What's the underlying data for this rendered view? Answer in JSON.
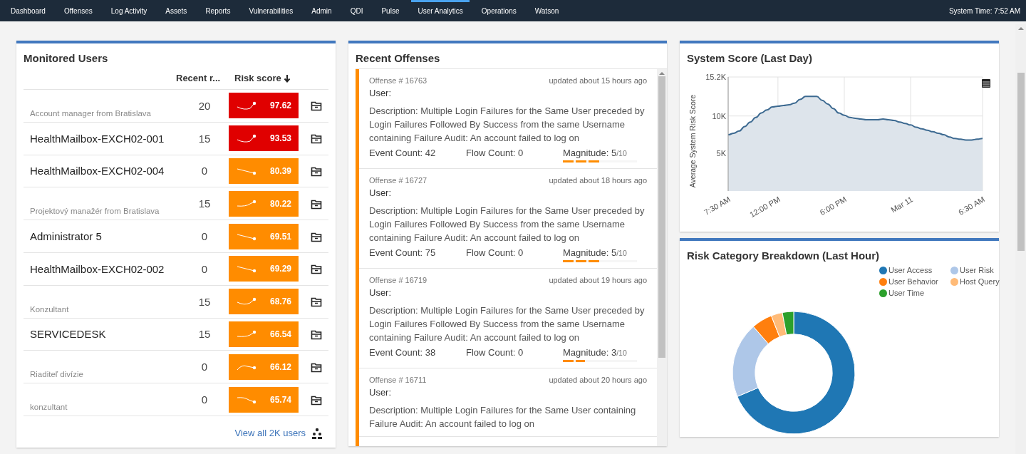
{
  "nav": {
    "items": [
      {
        "label": "Dashboard",
        "selected": false
      },
      {
        "label": "Offenses",
        "selected": false
      },
      {
        "label": "Log Activity",
        "selected": false
      },
      {
        "label": "Assets",
        "selected": false
      },
      {
        "label": "Reports",
        "selected": false
      },
      {
        "label": "Vulnerabilities",
        "selected": false
      },
      {
        "label": "Admin",
        "selected": false
      },
      {
        "label": "QDI",
        "selected": false
      },
      {
        "label": "Pulse",
        "selected": false
      },
      {
        "label": "User Analytics",
        "selected": true
      },
      {
        "label": "Operations",
        "selected": false
      },
      {
        "label": "Watson",
        "selected": false
      }
    ],
    "system_time": "System Time: 7:52 AM"
  },
  "monitored_users": {
    "title": "Monitored Users",
    "columns": [
      "Recent r...",
      "Risk score"
    ],
    "rows": [
      {
        "kind": "subtitle",
        "name": "Account manager from Bratislava",
        "recent": "20",
        "score": "97.62",
        "color": "#e00000"
      },
      {
        "kind": "name",
        "name": "HealthMailbox-EXCH02-001",
        "recent": "15",
        "score": "93.53",
        "color": "#e00000"
      },
      {
        "kind": "name",
        "name": "HealthMailbox-EXCH02-004",
        "recent": "0",
        "score": "80.39",
        "color": "#ff8c00"
      },
      {
        "kind": "subtitle",
        "name": "Projektový manažér from Bratislava",
        "recent": "15",
        "score": "80.22",
        "color": "#ff8c00"
      },
      {
        "kind": "name",
        "name": "Administrator 5",
        "recent": "0",
        "score": "69.51",
        "color": "#ff8c00"
      },
      {
        "kind": "name",
        "name": "HealthMailbox-EXCH02-002",
        "recent": "0",
        "score": "69.29",
        "color": "#ff8c00"
      },
      {
        "kind": "subtitle",
        "name": "Konzultant",
        "recent": "15",
        "score": "68.76",
        "color": "#ff8c00"
      },
      {
        "kind": "name",
        "name": "SERVICEDESK",
        "recent": "15",
        "score": "66.54",
        "color": "#ff8c00"
      },
      {
        "kind": "subtitle",
        "name": "Riaditeľ divízie",
        "recent": "0",
        "score": "66.12",
        "color": "#ff8c00"
      },
      {
        "kind": "subtitle",
        "name": "konzultant",
        "recent": "0",
        "score": "65.74",
        "color": "#ff8c00"
      }
    ],
    "view_all": "View all 2K users"
  },
  "recent_offenses": {
    "title": "Recent Offenses",
    "items": [
      {
        "number": "Offense # 16763",
        "updated": "updated about 15 hours ago",
        "user": "User:",
        "description": "Description: Multiple Login Failures for the Same User preceded by Login Failures Followed By Success from the same Username containing Failure Audit: An account failed to log on",
        "event_count": "Event Count: 42",
        "flow_count": "Flow Count: 0",
        "magnitude": {
          "label": "Magnitude:",
          "value": "5",
          "scale": "/10",
          "level": 0.5
        }
      },
      {
        "number": "Offense # 16727",
        "updated": "updated about 18 hours ago",
        "user": "User:",
        "description": "Description: Multiple Login Failures for the Same User preceded by Login Failures Followed By Success from the same Username containing Failure Audit: An account failed to log on",
        "event_count": "Event Count: 75",
        "flow_count": "Flow Count: 0",
        "magnitude": {
          "label": "Magnitude:",
          "value": "5",
          "scale": "/10",
          "level": 0.5
        }
      },
      {
        "number": "Offense # 16719",
        "updated": "updated about 19 hours ago",
        "user": "User:",
        "description": "Description: Multiple Login Failures for the Same User preceded by Login Failures Followed By Success from the same Username containing Failure Audit: An account failed to log on",
        "event_count": "Event Count: 38",
        "flow_count": "Flow Count: 0",
        "magnitude": {
          "label": "Magnitude:",
          "value": "3",
          "scale": "/10",
          "level": 0.3
        }
      },
      {
        "number": "Offense # 16711",
        "updated": "updated about 20 hours ago",
        "user": "User:",
        "description": "Description: Multiple Login Failures for the Same User containing Failure Audit: An account failed to log on"
      }
    ]
  },
  "system_score": {
    "title": "System Score (Last Day)",
    "chart_data": {
      "type": "area",
      "ylabel": "Average System Risk Score",
      "categories": [
        "7:30 AM",
        null,
        null,
        null,
        null,
        null,
        null,
        null,
        null,
        "12:00 PM",
        null,
        null,
        null,
        null,
        null,
        null,
        null,
        null,
        null,
        null,
        null,
        "6:00 PM",
        null,
        null,
        null,
        null,
        null,
        null,
        null,
        null,
        null,
        null,
        null,
        "Mar 11",
        null,
        null,
        null,
        null,
        null,
        null,
        null,
        null,
        null,
        null,
        null,
        null,
        "6:30 AM"
      ],
      "series": [
        {
          "color": "#3d6a91",
          "values": [
            7500,
            7700,
            8000,
            8600,
            9200,
            9800,
            10400,
            10800,
            11200,
            11300,
            11400,
            11500,
            11700,
            12200,
            12600,
            12600,
            12600,
            12100,
            11600,
            11000,
            10400,
            10100,
            9800,
            9700,
            9600,
            9500,
            9500,
            9500,
            9600,
            9500,
            9400,
            9200,
            9000,
            8800,
            8500,
            8300,
            8100,
            7900,
            7700,
            7500,
            7200,
            7000,
            6900,
            6800,
            6800,
            6900,
            7000
          ]
        }
      ],
      "ylim": [
        0,
        15200
      ],
      "grid": true,
      "yticks": [
        {
          "value": 5000,
          "label": "5K"
        },
        {
          "value": 10000,
          "label": "10K"
        },
        {
          "value": 15200,
          "label": "15.2K"
        }
      ]
    }
  },
  "risk_breakdown": {
    "title": "Risk Category Breakdown (Last Hour)",
    "chart_data": {
      "type": "donut",
      "categories": [
        "User Access",
        "User Risk",
        "User Behavior",
        "Host Query",
        "User Time"
      ],
      "series": [
        {
          "values": [
            69,
            20,
            5.5,
            3,
            3
          ]
        }
      ],
      "colors": [
        "#1f77b4",
        "#aec7e8",
        "#ff7f0e",
        "#ffbb78",
        "#2ca02c"
      ]
    }
  }
}
